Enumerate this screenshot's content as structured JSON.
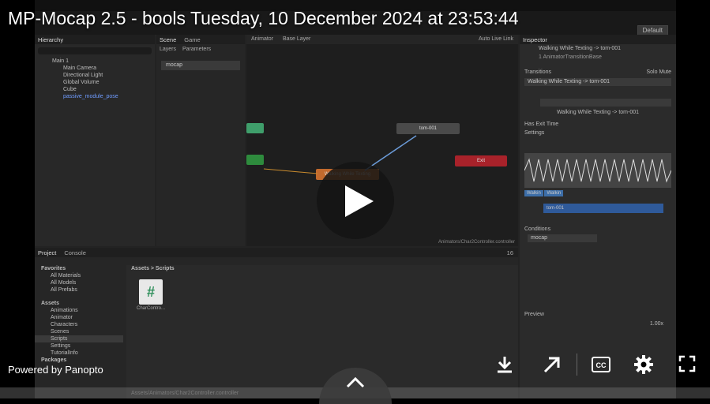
{
  "video": {
    "title": "MP-Mocap 2.5 - bools Tuesday, 10 December 2024 at 23:53:44",
    "powered_by": "Powered by Panopto"
  },
  "unity": {
    "toolbar": {
      "layout": "Default"
    },
    "hierarchy": {
      "tab": "Hierarchy",
      "items": [
        "Main 1",
        "Main Camera",
        "Directional Light",
        "Global Volume",
        "Cube",
        "passive_module_pose"
      ]
    },
    "scene_tabs": {
      "scene": "Scene",
      "game": "Game",
      "animator": "Animator"
    },
    "layers": {
      "layers_label": "Layers",
      "parameters_label": "Parameters",
      "param": "mocap"
    },
    "graph": {
      "base_layer": "Base Layer",
      "auto_live_link": "Auto Live Link",
      "path": "Animators/Char2Controller.controller",
      "nodes": {
        "tom": "tom-001",
        "walking": "Walking While Texting",
        "exit": "Exit"
      }
    },
    "inspector": {
      "tab": "Inspector",
      "heading": "Walking While Texting -> tom-001",
      "subheading": "1 AnimatorTransitionBase",
      "transitions_label": "Transitions",
      "solo": "Solo",
      "mute": "Mute",
      "transition_row": "Walking While Texting -> tom-001",
      "transition_name": "Walking While Texting -> tom-001",
      "has_exit_time": "Has Exit Time",
      "settings": "Settings",
      "clip_a": "Walkin",
      "clip_b": "Walkin",
      "clip_c": "tom-001",
      "conditions": "Conditions",
      "condition_param": "mocap",
      "preview": "Preview",
      "preview_speed": "1.00x"
    },
    "project": {
      "tab_project": "Project",
      "tab_console": "Console",
      "favorites": "Favorites",
      "fav_items": [
        "All Materials",
        "All Models",
        "All Prefabs"
      ],
      "assets": "Assets",
      "asset_items": [
        "Animations",
        "Animator",
        "Characters",
        "Scenes",
        "Scripts",
        "Settings",
        "TutorialInfo"
      ],
      "packages": "Packages",
      "breadcrumb": "Assets > Scripts",
      "file_label": "CharContro...",
      "script_glyph": "#",
      "bottom_path": "Assets/Animators/Char2Controller.controller",
      "count": "16"
    }
  }
}
